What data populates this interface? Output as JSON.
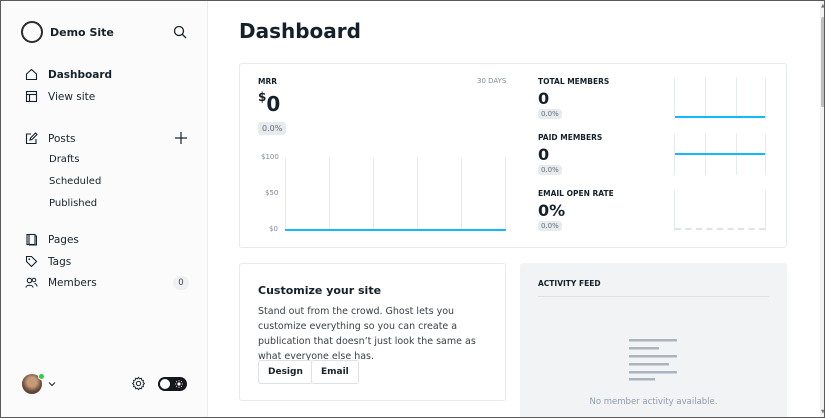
{
  "site": {
    "name": "Demo Site"
  },
  "sidebar": {
    "items": [
      {
        "label": "Dashboard"
      },
      {
        "label": "View site"
      },
      {
        "label": "Posts"
      },
      {
        "label": "Drafts"
      },
      {
        "label": "Scheduled"
      },
      {
        "label": "Published"
      },
      {
        "label": "Pages"
      },
      {
        "label": "Tags"
      },
      {
        "label": "Members",
        "count": "0"
      }
    ]
  },
  "page": {
    "title": "Dashboard"
  },
  "mrr": {
    "label": "MRR",
    "range": "30 DAYS",
    "currency": "$",
    "value": "0",
    "change": "0.0%",
    "y_ticks": [
      "$100",
      "$50",
      "$0"
    ]
  },
  "chart_data": [
    {
      "type": "line",
      "title": "MRR",
      "ylabel": "",
      "y_ticks": [
        "$100",
        "$50",
        "$0"
      ],
      "series": [
        {
          "values": [
            0,
            0,
            0,
            0,
            0,
            0,
            0,
            0,
            0,
            0,
            0,
            0,
            0,
            0,
            0,
            0,
            0,
            0,
            0,
            0,
            0,
            0,
            0,
            0,
            0,
            0,
            0,
            0,
            0,
            0
          ]
        }
      ]
    },
    {
      "type": "line",
      "title": "TOTAL MEMBERS",
      "series": [
        {
          "values": [
            0,
            0,
            0,
            0,
            0,
            0,
            0,
            0,
            0,
            0,
            0,
            0,
            0,
            0,
            0,
            0,
            0,
            0,
            0,
            0,
            0,
            0,
            0,
            0,
            0,
            0,
            0,
            0,
            0,
            0
          ]
        }
      ]
    },
    {
      "type": "line",
      "title": "PAID MEMBERS",
      "series": [
        {
          "values": [
            0,
            0,
            0,
            0,
            0,
            0,
            0,
            0,
            0,
            0,
            0,
            0,
            0,
            0,
            0,
            0,
            0,
            0,
            0,
            0,
            0,
            0,
            0,
            0,
            0,
            0,
            0,
            0,
            0,
            0
          ]
        }
      ]
    },
    {
      "type": "bar",
      "title": "EMAIL OPEN RATE",
      "series": [
        {
          "values": [
            0,
            0,
            0,
            0,
            0
          ]
        }
      ]
    }
  ],
  "metrics": [
    {
      "label": "TOTAL MEMBERS",
      "value": "0",
      "change": "0.0%"
    },
    {
      "label": "PAID MEMBERS",
      "value": "0",
      "change": "0.0%"
    },
    {
      "label": "EMAIL OPEN RATE",
      "value": "0%",
      "change": "0.0%"
    }
  ],
  "customize": {
    "title": "Customize your site",
    "text": "Stand out from the crowd. Ghost lets you customize everything so you can create a publication that doesn’t just look the same as what everyone else has.",
    "design_label": "Design",
    "email_label": "Email"
  },
  "activity": {
    "title": "ACTIVITY FEED",
    "empty": "No member activity available."
  },
  "colors": {
    "accent": "#14b8ff",
    "online": "#30cf43",
    "text": "#15212a"
  },
  "icons": [
    "ghost-logo-icon",
    "search-icon",
    "home-icon",
    "view-site-icon",
    "edit-icon",
    "plus-icon",
    "pages-icon",
    "tag-icon",
    "members-icon",
    "chevron-down-icon",
    "gear-icon",
    "sun-icon",
    "list-icon"
  ]
}
